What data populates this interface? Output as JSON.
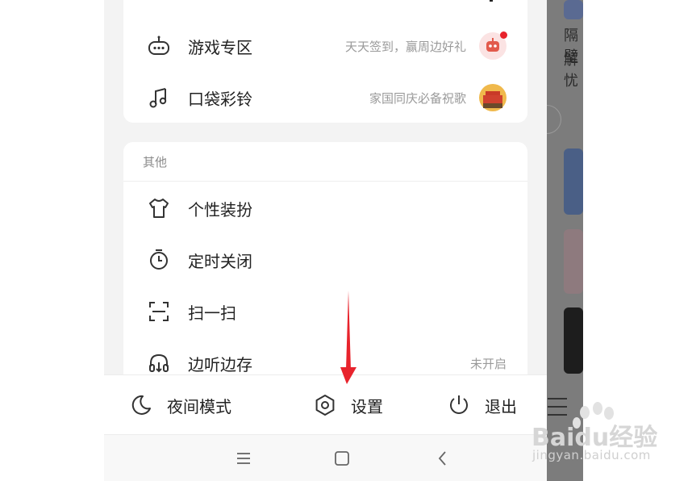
{
  "menu_top": {
    "items": [
      {
        "label": "游戏专区",
        "hint": "天天签到，赢周边好礼",
        "icon": "gamepad-icon"
      },
      {
        "label": "口袋彩铃",
        "hint": "家国同庆必备祝歌",
        "icon": "music-note-icon"
      }
    ]
  },
  "menu_other": {
    "title": "其他",
    "items": [
      {
        "label": "个性装扮",
        "icon": "tshirt-icon"
      },
      {
        "label": "定时关闭",
        "icon": "timer-icon"
      },
      {
        "label": "扫一扫",
        "icon": "scan-icon"
      },
      {
        "label": "边听边存",
        "status": "未开启",
        "icon": "headphones-download-icon"
      }
    ]
  },
  "bottom_bar": {
    "night_mode": "夜间模式",
    "settings": "设置",
    "logout": "退出"
  },
  "background": {
    "text_lines": [
      "隔壁",
      "解忧"
    ]
  },
  "watermark": {
    "logo_text": "Baidu经验",
    "url": "jingyan.baidu.com"
  },
  "colors": {
    "arrow": "#e8232c",
    "badge": "#e8232c",
    "drawer_bg": "#f3f3f3",
    "overlay": "#7b7b7b"
  }
}
